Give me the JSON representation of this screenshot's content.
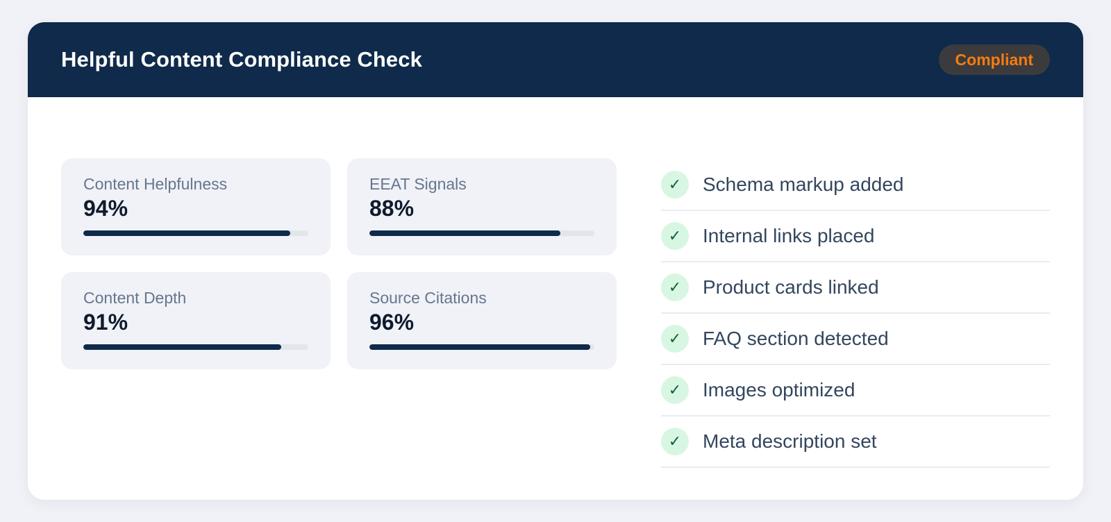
{
  "header": {
    "title": "Helpful Content Compliance Check",
    "status_badge": "Compliant"
  },
  "colors": {
    "header_bg": "#0f2a4a",
    "badge_text": "#f57c10",
    "bar_fill": "#0f2a4a",
    "check_bg": "#d8f7e2",
    "check_mark": "#12633a"
  },
  "metrics": [
    {
      "label": "Content Helpfulness",
      "value": "94%",
      "progress": 0.92
    },
    {
      "label": "EEAT Signals",
      "value": "88%",
      "progress": 0.85
    },
    {
      "label": "Content Depth",
      "value": "91%",
      "progress": 0.88
    },
    {
      "label": "Source Citations",
      "value": "96%",
      "progress": 0.98
    }
  ],
  "checklist": {
    "icon": "check-icon",
    "icon_glyph": "✓",
    "items": [
      "Schema markup added",
      "Internal links placed",
      "Product cards linked",
      "FAQ section detected",
      "Images optimized",
      "Meta description set"
    ]
  }
}
